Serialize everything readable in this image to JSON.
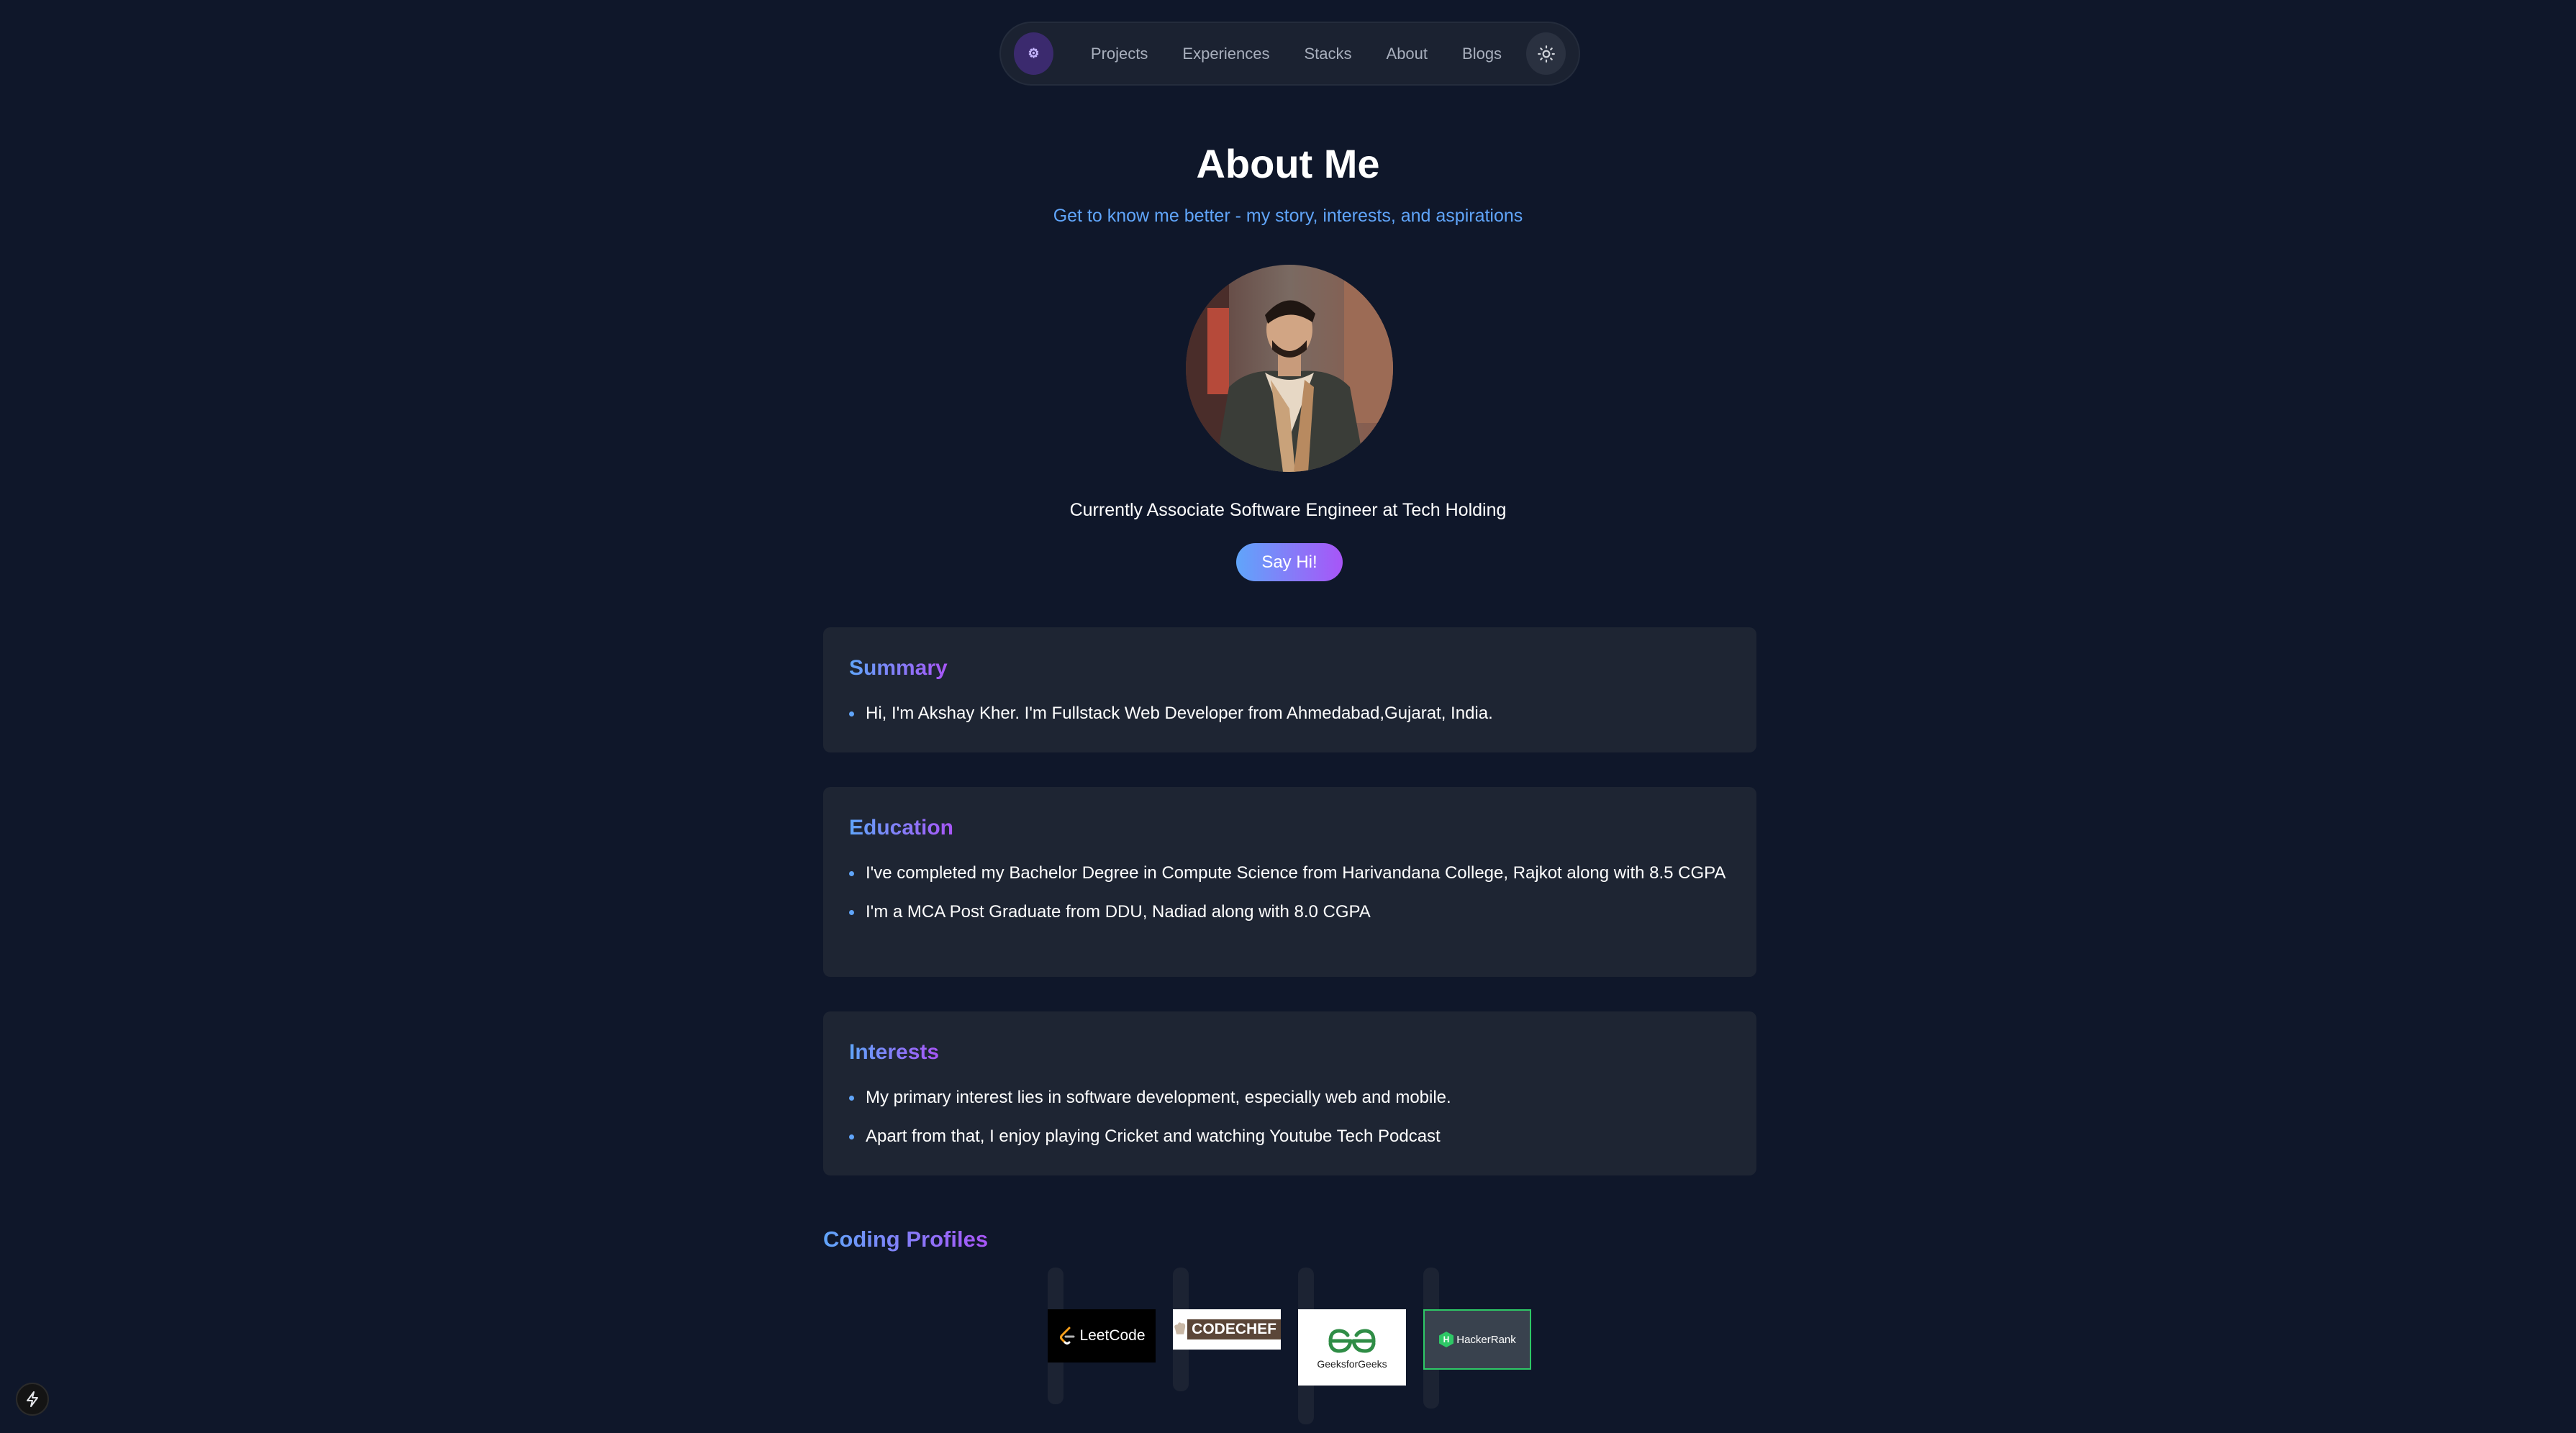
{
  "nav": {
    "logo_glyph": "⚙",
    "links": [
      "Projects",
      "Experiences",
      "Stacks",
      "About",
      "Blogs"
    ],
    "theme_icon": "sun-icon"
  },
  "header": {
    "title": "About Me",
    "subtitle": "Get to know me better - my story, interests, and aspirations"
  },
  "profile": {
    "role": "Currently Associate Software Engineer at Tech Holding",
    "cta_label": "Say Hi!"
  },
  "sections": {
    "summary": {
      "title": "Summary",
      "items": [
        "Hi, I'm Akshay Kher. I'm Fullstack Web Developer from Ahmedabad,Gujarat, India."
      ]
    },
    "education": {
      "title": "Education",
      "items": [
        "I've completed my Bachelor Degree in Compute Science from Harivandana College, Rajkot along with 8.5 CGPA",
        "I'm a MCA Post Graduate from DDU, Nadiad along with 8.0 CGPA"
      ]
    },
    "interests": {
      "title": "Interests",
      "items": [
        "My primary interest lies in software development, especially web and mobile.",
        "Apart from that, I enjoy playing Cricket and watching Youtube Tech Podcast"
      ]
    }
  },
  "coding_profiles": {
    "title": "Coding Profiles",
    "items": [
      {
        "name": "LeetCode",
        "bg": "#000000",
        "fg": "#ffffff",
        "accent": "#f89f1b"
      },
      {
        "name": "CODECHEF",
        "bg": "#ffffff",
        "fg": "#5b4638",
        "accent": "#5b4638"
      },
      {
        "name": "GeeksforGeeks",
        "bg": "#ffffff",
        "fg": "#2f8d46",
        "accent": "#2f8d46"
      },
      {
        "name": "HackerRank",
        "bg": "#39424e",
        "fg": "#ffffff",
        "accent": "#2ec866"
      }
    ]
  },
  "colors": {
    "background": "#0f172a",
    "card": "#1e2533",
    "accent_blue": "#60a5fa",
    "accent_purple": "#a855f7"
  }
}
